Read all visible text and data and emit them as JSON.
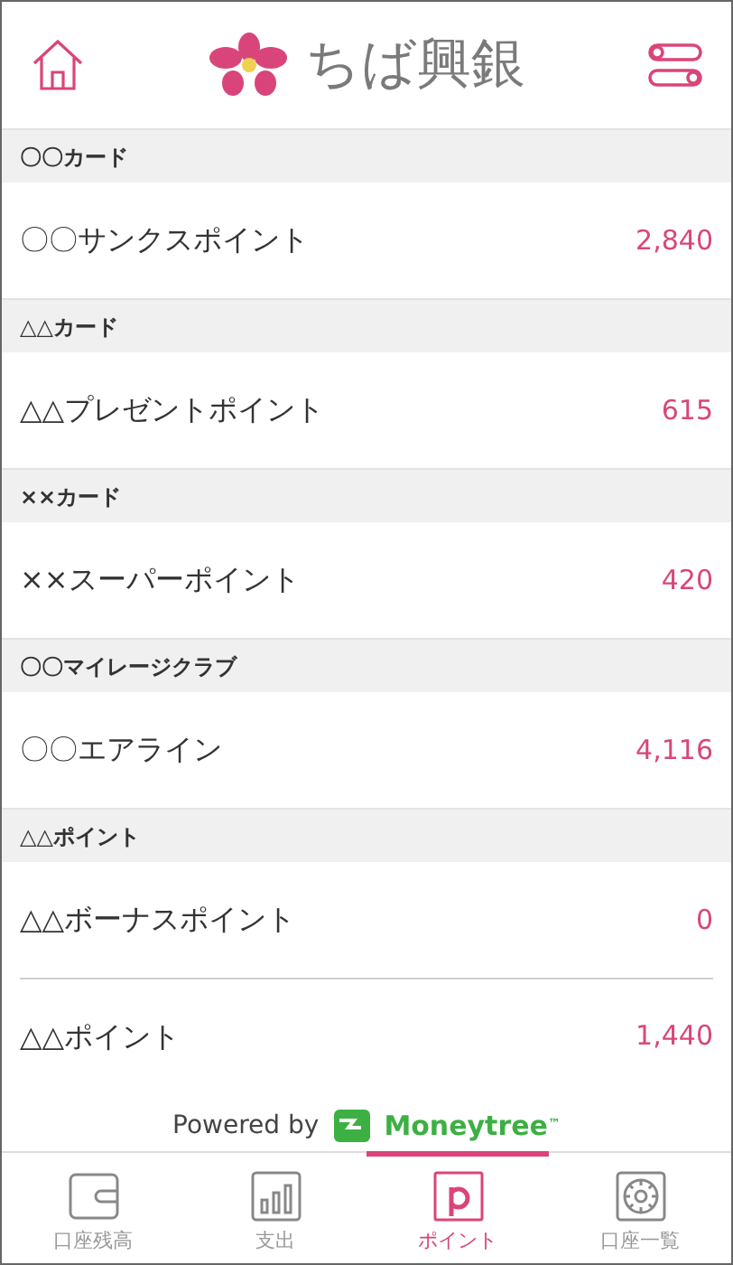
{
  "header": {
    "logo_text": "ちば興銀"
  },
  "sections": [
    {
      "title": "〇〇カード",
      "items": [
        {
          "name": "〇〇サンクスポイント",
          "points": "2,840"
        }
      ]
    },
    {
      "title": "△△カード",
      "items": [
        {
          "name": "△△プレゼントポイント",
          "points": "615"
        }
      ]
    },
    {
      "title": "××カード",
      "items": [
        {
          "name": "××スーパーポイント",
          "points": "420"
        }
      ]
    },
    {
      "title": "〇〇マイレージクラブ",
      "items": [
        {
          "name": "〇〇エアライン",
          "points": "4,116"
        }
      ]
    },
    {
      "title": "△△ポイント",
      "items": [
        {
          "name": "△△ボーナスポイント",
          "points": "0"
        },
        {
          "name": "△△ポイント",
          "points": "1,440"
        }
      ]
    }
  ],
  "powered_by": {
    "label": "Powered by",
    "brand": "Moneytree",
    "trademark": "™"
  },
  "tabs": [
    {
      "label": "口座残高",
      "kind": "wallet",
      "selected": false
    },
    {
      "label": "支出",
      "kind": "chart",
      "selected": false
    },
    {
      "label": "ポイント",
      "kind": "points",
      "selected": true
    },
    {
      "label": "口座一覧",
      "kind": "safe",
      "selected": false
    }
  ]
}
